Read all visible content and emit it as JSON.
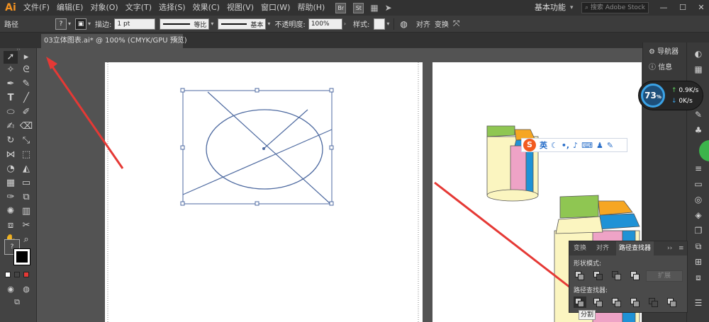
{
  "app": {
    "logo": "Ai",
    "menus": [
      "文件(F)",
      "编辑(E)",
      "对象(O)",
      "文字(T)",
      "选择(S)",
      "效果(C)",
      "视图(V)",
      "窗口(W)",
      "帮助(H)"
    ],
    "bridge_icon": "Br",
    "stock_icon": "St",
    "workspace": "基本功能",
    "search_placeholder": "搜索 Adobe Stock"
  },
  "control_bar": {
    "selection_type": "路径",
    "fill_label": "?",
    "stroke_label": "描边:",
    "stroke_weight": "1 pt",
    "profile_label": "等比",
    "brush_label": "基本",
    "opacity_label": "不透明度:",
    "opacity_value": "100%",
    "style_label": "样式:",
    "align_label": "对齐",
    "transform_label": "变换"
  },
  "document_tab": {
    "title": "03立体图表.ai* @ 100% (CMYK/GPU 预览)",
    "close": "×"
  },
  "right_dock": {
    "navigator": "导航器",
    "info": "信息"
  },
  "speed_widget": {
    "percent": "73",
    "percent_unit": "%",
    "up": "0.9K/s",
    "down": "0K/s"
  },
  "ime_bar": {
    "logo": "S",
    "lang": "英"
  },
  "pathfinder": {
    "tabs": [
      "变换",
      "对齐",
      "路径查找器"
    ],
    "active_tab": "路径查找器",
    "shape_modes_label": "形状模式:",
    "expand_label": "扩展",
    "pathfinders_label": "路径查找器:",
    "tooltip": "分割"
  },
  "colors": {
    "menubar": "#323232",
    "canvas": "#535353",
    "ai_orange": "#f39221",
    "arrow_red": "#e53935",
    "path_blue": "#4e6aa0",
    "cyl_yellow": "#fbf5c0",
    "cyl_pink": "#eea3c6",
    "cyl_blue": "#1f92d6",
    "cyl_green": "#8fc652",
    "cyl_orange": "#f6a622"
  }
}
